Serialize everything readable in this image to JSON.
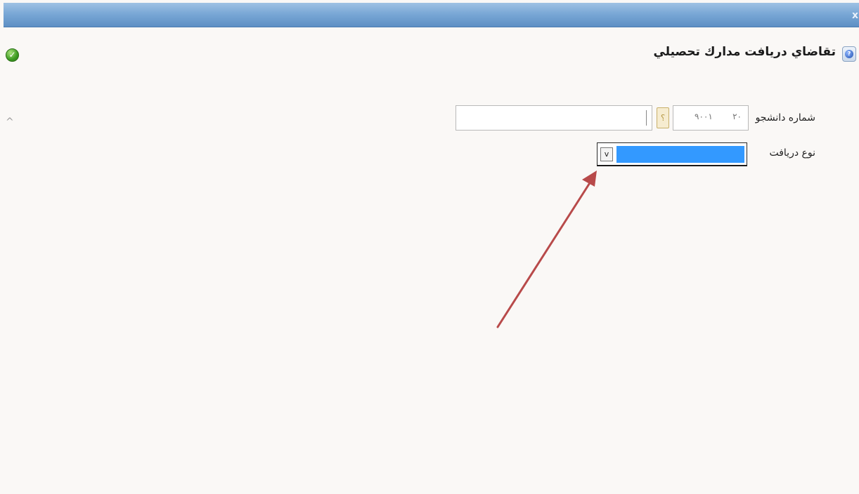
{
  "window": {
    "close_label": "x"
  },
  "header": {
    "title": "تقاضاي دريافت مدارك تحصيلي",
    "help_glyph": "?",
    "ok_glyph": "✓"
  },
  "form": {
    "student_number": {
      "label": "شماره دانشجو",
      "value_main": "۹۰۰۱",
      "value_prefix": "۲۰"
    },
    "lookup_button_label": "؟",
    "receive_type": {
      "label": "نوع دريافت",
      "selected_value": "",
      "arrow_glyph": "v"
    }
  },
  "collapse_glyph": "^",
  "colors": {
    "titlebar": "#7aa8d6",
    "selection": "#3399ff",
    "annotation_arrow": "#b84a4a"
  },
  "icons": [
    "help-icon",
    "ok-icon",
    "collapse-icon",
    "dropdown-arrow-icon"
  ]
}
